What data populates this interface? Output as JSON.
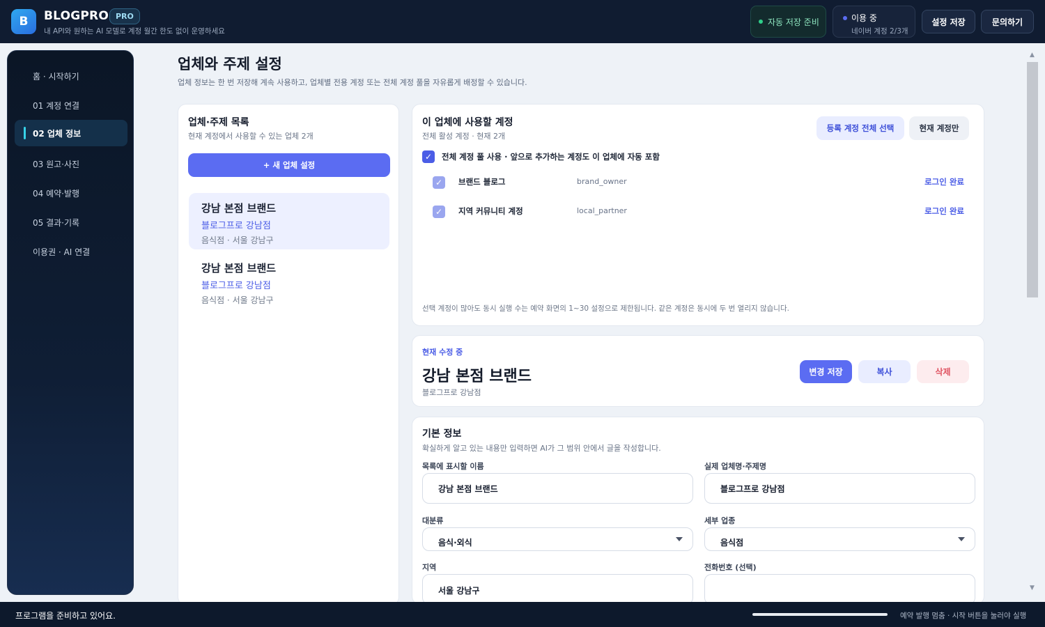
{
  "header": {
    "logo_letter": "B",
    "brand": "BLOGPRO",
    "badge": "PRO",
    "subtitle": "내 API와 원하는 AI 모델로 계정 월간 한도 없이 운영하세요",
    "autosave": "자동 저장 준비",
    "usage_title": "이용 중",
    "usage_detail": "네이버 계정 2/3개",
    "save_settings": "설정 저장",
    "contact": "문의하기",
    "colors": {
      "autosave_dot": "#2fcf8a",
      "usage_dot": "#5b6cf2"
    }
  },
  "sidebar": {
    "items": [
      {
        "label": "홈 · 시작하기"
      },
      {
        "label": "01  계정 연결"
      },
      {
        "label": "02  업체 정보",
        "active": true
      },
      {
        "label": "03  원고·사진"
      },
      {
        "label": "04  예약·발행"
      },
      {
        "label": "05  결과·기록"
      },
      {
        "label": "이용권 · AI 연결"
      }
    ]
  },
  "main": {
    "title": "업체와 주제 설정",
    "subtitle": "업체 정보는 한 번 저장해 계속 사용하고, 업체별 전용 계정 또는 전체 계정 풀을 자유롭게 배정할 수 있습니다."
  },
  "business_list": {
    "title": "업체·주제 목록",
    "subtitle": "현재 계정에서 사용할 수 있는 업체 2개",
    "new_button": "+ 새 업체 설정",
    "items": [
      {
        "name": "강남 본점 브랜드",
        "real_name": "블로그프로 강남점",
        "meta": "음식점 · 서울 강남구",
        "selected": true
      },
      {
        "name": "강남 본점 브랜드",
        "real_name": "블로그프로 강남점",
        "meta": "음식점 · 서울 강남구",
        "selected": false
      }
    ]
  },
  "accounts": {
    "title": "이 업체에 사용할 계정",
    "subtitle": "전체 활성 계정 · 현재 2개",
    "select_all": "등록 계정 전체 선택",
    "current_only": "현재 계정만",
    "pool_label": "전체 계정 풀 사용 · 앞으로 추가하는 계정도 이 업체에 자동 포함",
    "check_mark": "✓",
    "rows": [
      {
        "name": "브랜드 블로그",
        "id": "brand_owner",
        "status": "로그인 완료"
      },
      {
        "name": "지역 커뮤니티 계정",
        "id": "local_partner",
        "status": "로그인 완료"
      }
    ],
    "note": "선택 계정이 많아도 동시 실행 수는 예약 화면의 1~30 설정으로 제한됩니다. 같은 계정은 동시에 두 번 열리지 않습니다."
  },
  "editing": {
    "tag": "현재 수정 중",
    "name": "강남 본점 브랜드",
    "real_name": "블로그프로 강남점",
    "save": "변경 저장",
    "copy": "복사",
    "delete": "삭제"
  },
  "basic_info": {
    "title": "기본 정보",
    "subtitle": "확실하게 알고 있는 내용만 입력하면 AI가 그 범위 안에서 글을 작성합니다.",
    "display_name_label": "목록에 표시할 이름",
    "display_name_value": "강남 본점 브랜드",
    "real_name_label": "실제 업체명·주제명",
    "real_name_value": "블로그프로 강남점",
    "category_label": "대분류",
    "category_value": "음식·외식",
    "subcategory_label": "세부 업종",
    "subcategory_value": "음식점",
    "region_label": "지역",
    "region_value": "서울 강남구",
    "phone_label": "전화번호 (선택)",
    "phone_value": ""
  },
  "footer": {
    "status": "프로그램을 준비하고 있어요.",
    "progress": 1.0,
    "hint": "예약 발행 멈춤 · 시작 버튼을 눌러야 실행"
  },
  "scrollbar": {
    "up_arrow": "▲",
    "down_arrow": "▼"
  }
}
